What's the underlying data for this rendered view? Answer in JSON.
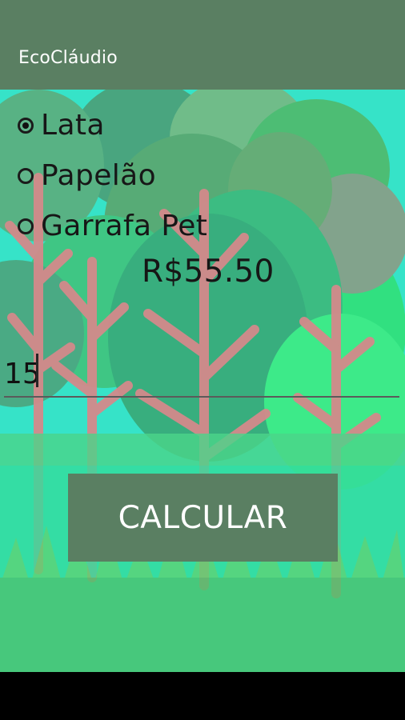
{
  "app": {
    "title": "EcoCláudio"
  },
  "materials": [
    {
      "label": "Lata",
      "checked": true
    },
    {
      "label": "Papelão",
      "checked": false
    },
    {
      "label": "Garrafa Pet",
      "checked": false
    }
  ],
  "result": {
    "price": "R$55.50"
  },
  "form": {
    "quantity": "15"
  },
  "actions": {
    "calculate_label": "CALCULAR"
  },
  "colors": {
    "toolbar": "#5a7f62",
    "button": "#5a7f62",
    "background_ground": "#49d49b",
    "background_trunk": "#d38a8b",
    "background_tree": "#45cc7f"
  }
}
